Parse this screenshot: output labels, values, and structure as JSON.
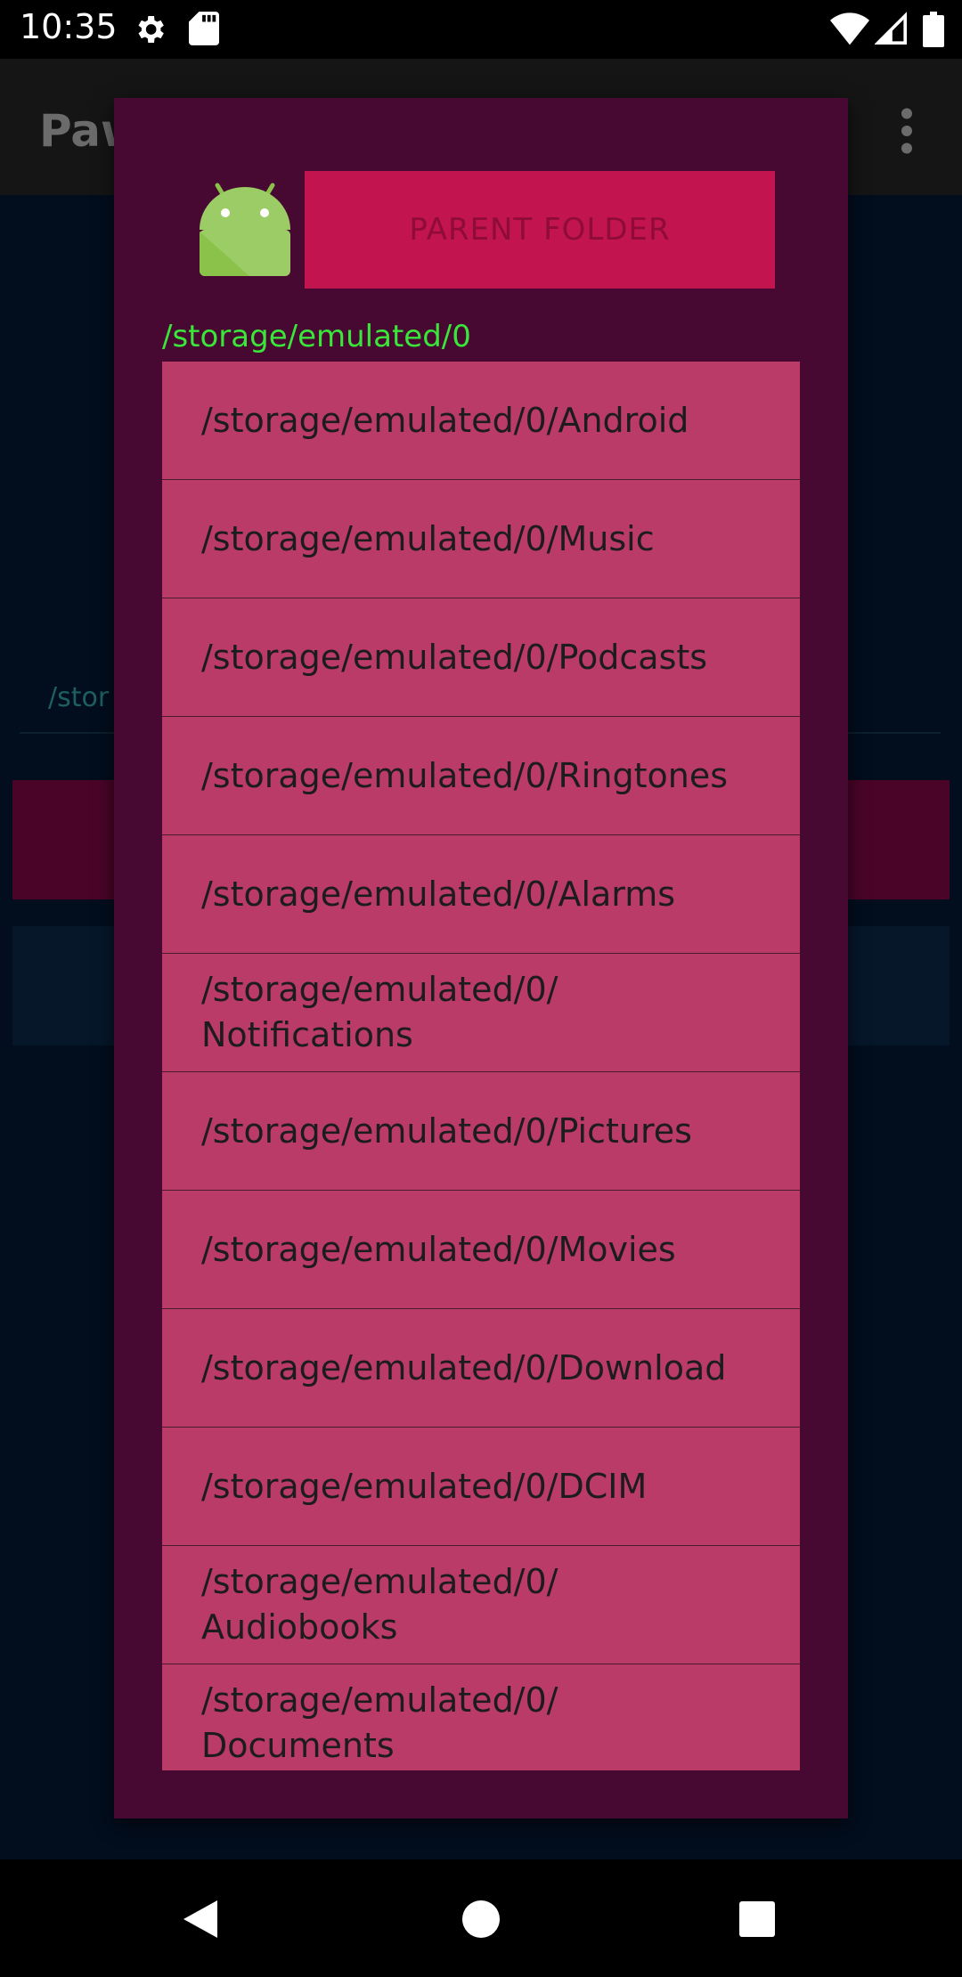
{
  "status_bar": {
    "time": "10:35",
    "icons": [
      "gear-icon",
      "sd-card-icon",
      "wifi-icon",
      "signal-icon",
      "battery-icon"
    ]
  },
  "background_app": {
    "title": "Paw",
    "path_text": "/stor",
    "menu_icon": "overflow-menu-icon"
  },
  "dialog": {
    "icon": "android-icon",
    "parent_button_label": "PARENT FOLDER",
    "current_path": "/storage/emulated/0",
    "folders": [
      "/storage/emulated/0/Android",
      "/storage/emulated/0/Music",
      "/storage/emulated/0/Podcasts",
      "/storage/emulated/0/Ringtones",
      "/storage/emulated/0/Alarms",
      "/storage/emulated/0/\nNotifications",
      "/storage/emulated/0/Pictures",
      "/storage/emulated/0/Movies",
      "/storage/emulated/0/Download",
      "/storage/emulated/0/DCIM",
      "/storage/emulated/0/\nAudiobooks",
      "/storage/emulated/0/\nDocuments"
    ]
  },
  "nav_bar": {
    "buttons": [
      "back-icon",
      "home-icon",
      "recents-icon"
    ]
  },
  "colors": {
    "dialog_bg": "#470931",
    "parent_button": "#c2154f",
    "list_item": "#bb3b68",
    "path_text": "#3ae63a",
    "app_bg": "#020d1d"
  }
}
